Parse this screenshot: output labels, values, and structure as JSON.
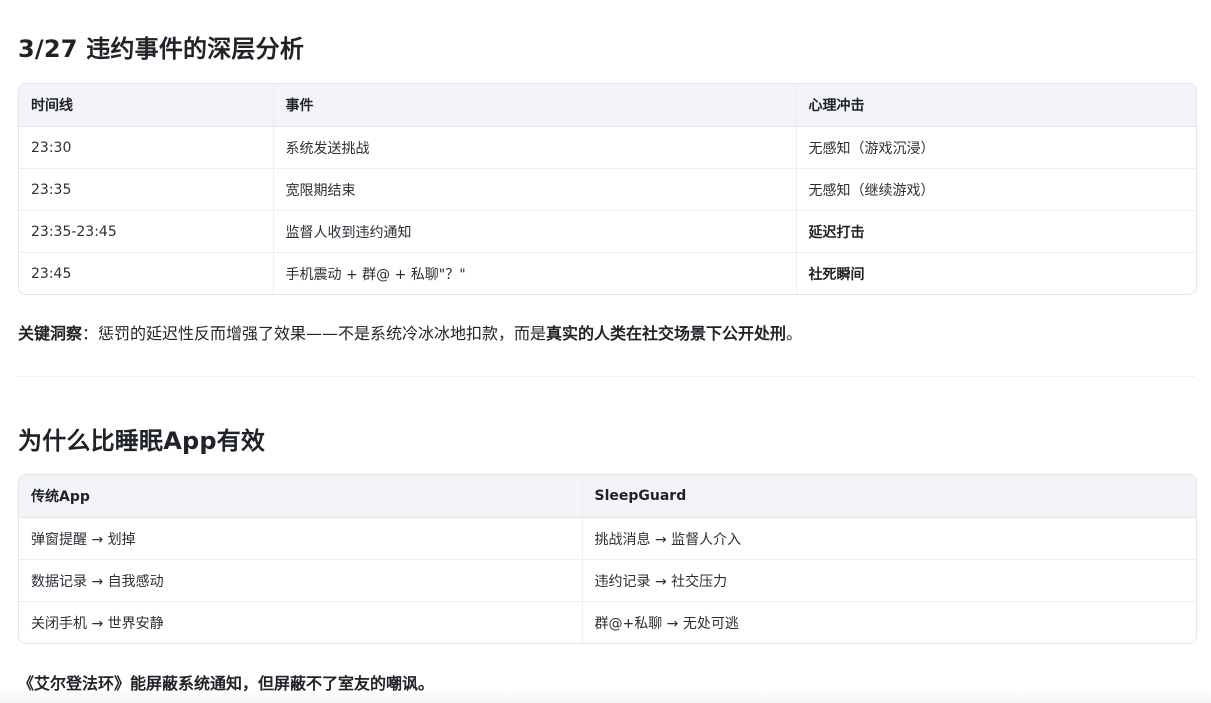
{
  "section1": {
    "title": "3/27 违约事件的深层分析",
    "table": {
      "headers": [
        "时间线",
        "事件",
        "心理冲击"
      ],
      "rows": [
        [
          "23:30",
          "系统发送挑战",
          "无感知（游戏沉浸）"
        ],
        [
          "23:35",
          "宽限期结束",
          "无感知（继续游戏）"
        ],
        [
          "23:35-23:45",
          "监督人收到违约通知",
          "延迟打击"
        ],
        [
          "23:45",
          "手机震动 + 群@ + 私聊\"？\"",
          "社死瞬间"
        ]
      ]
    },
    "insight": {
      "label": "关键洞察",
      "sep": "：",
      "text": "惩罚的延迟性反而增强了效果——不是系统冷冰冰地扣款，而是",
      "emphasis": "真实的人类在社交场景下公开处刑",
      "end": "。"
    }
  },
  "section2": {
    "title": "为什么比睡眠App有效",
    "table": {
      "headers": [
        "传统App",
        "SleepGuard"
      ],
      "rows": [
        [
          "弹窗提醒 → 划掉",
          "挑战消息 → 监督人介入"
        ],
        [
          "数据记录 → 自我感动",
          "违约记录 → 社交压力"
        ],
        [
          "关闭手机 → 世界安静",
          "群@+私聊 → 无处可逃"
        ]
      ]
    },
    "closing": "《艾尔登法环》能屏蔽系统通知，但屏蔽不了室友的嘲讽。"
  }
}
